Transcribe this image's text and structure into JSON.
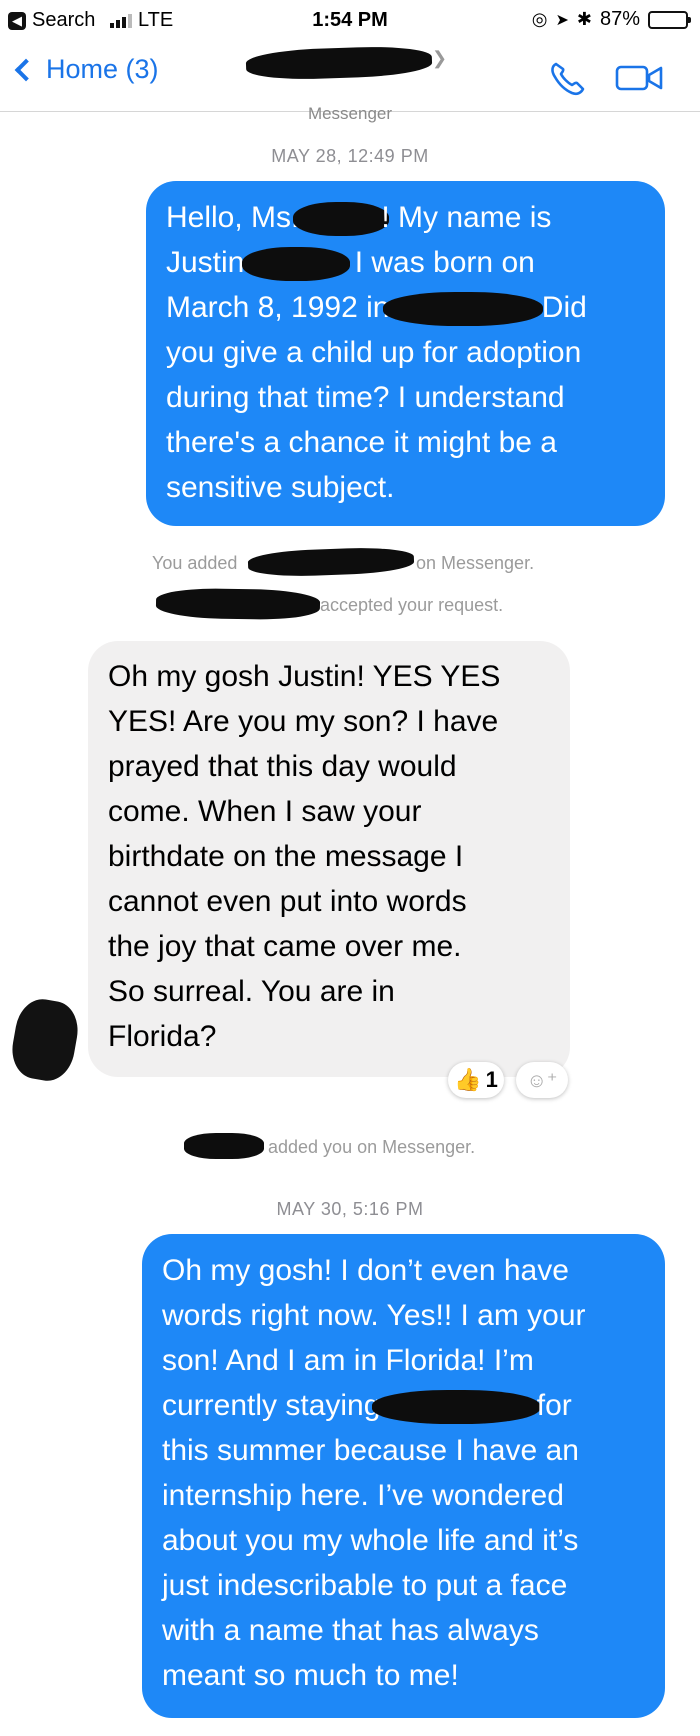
{
  "status_bar": {
    "back_app": "Search",
    "carrier": "LTE",
    "time": "1:54 PM",
    "battery": "87%",
    "battery_level": 0.87
  },
  "nav": {
    "back_label": "Home (3)",
    "subtitle": "Messenger"
  },
  "timestamps": [
    "MAY 28, 12:49 PM",
    "MAY 30, 5:16 PM"
  ],
  "messages": {
    "m1": {
      "l1a": "Hello, Ms.",
      "l1b": "! My name is",
      "l2a": "Justin",
      "l2b": " I was born on",
      "l3a": "March 8, 1992 in",
      "l3b": " Did",
      "l4": "you give a child up for adoption",
      "l5": "during that time? I understand",
      "l6": "there's a chance it might be a",
      "l7": "sensitive subject."
    },
    "m2": {
      "lines": [
        "Oh my gosh Justin! YES YES",
        "YES! Are you my son? I have",
        "prayed that this day would",
        "come. When I saw your",
        "birthdate on the message I",
        "cannot even put into words",
        "the joy  that came over me.",
        "So surreal.  You are in",
        "Florida?"
      ],
      "reaction_count": "1"
    },
    "m3": {
      "l1": "Oh my gosh! I don’t even have",
      "l2": "words right now. Yes!! I am your",
      "l3": "son! And I am in Florida! I’m",
      "l4a": "currently staying",
      "l4b": " for",
      "l5": "this summer because I have an",
      "l6": "internship here. I’ve wondered",
      "l7": "about you my whole life and it’s",
      "l8": "just indescribable to put a face",
      "l9": "with a name that has always",
      "l10": "meant so much to me!"
    }
  },
  "system": {
    "added_prefix": "You added",
    "added_suffix": "on Messenger.",
    "accepted": "accepted your request.",
    "added_you": "added you on Messenger."
  },
  "icons": {
    "back_app": "chevron-left-icon",
    "phone": "phone-icon",
    "video": "video-camera-icon",
    "reaction": "thumbs-up-icon",
    "add_reaction": "add-reaction-icon"
  },
  "colors": {
    "accent": "#1a74e8",
    "outgoing_bubble": "#1e88f7",
    "incoming_bubble": "#f1f0f0"
  }
}
